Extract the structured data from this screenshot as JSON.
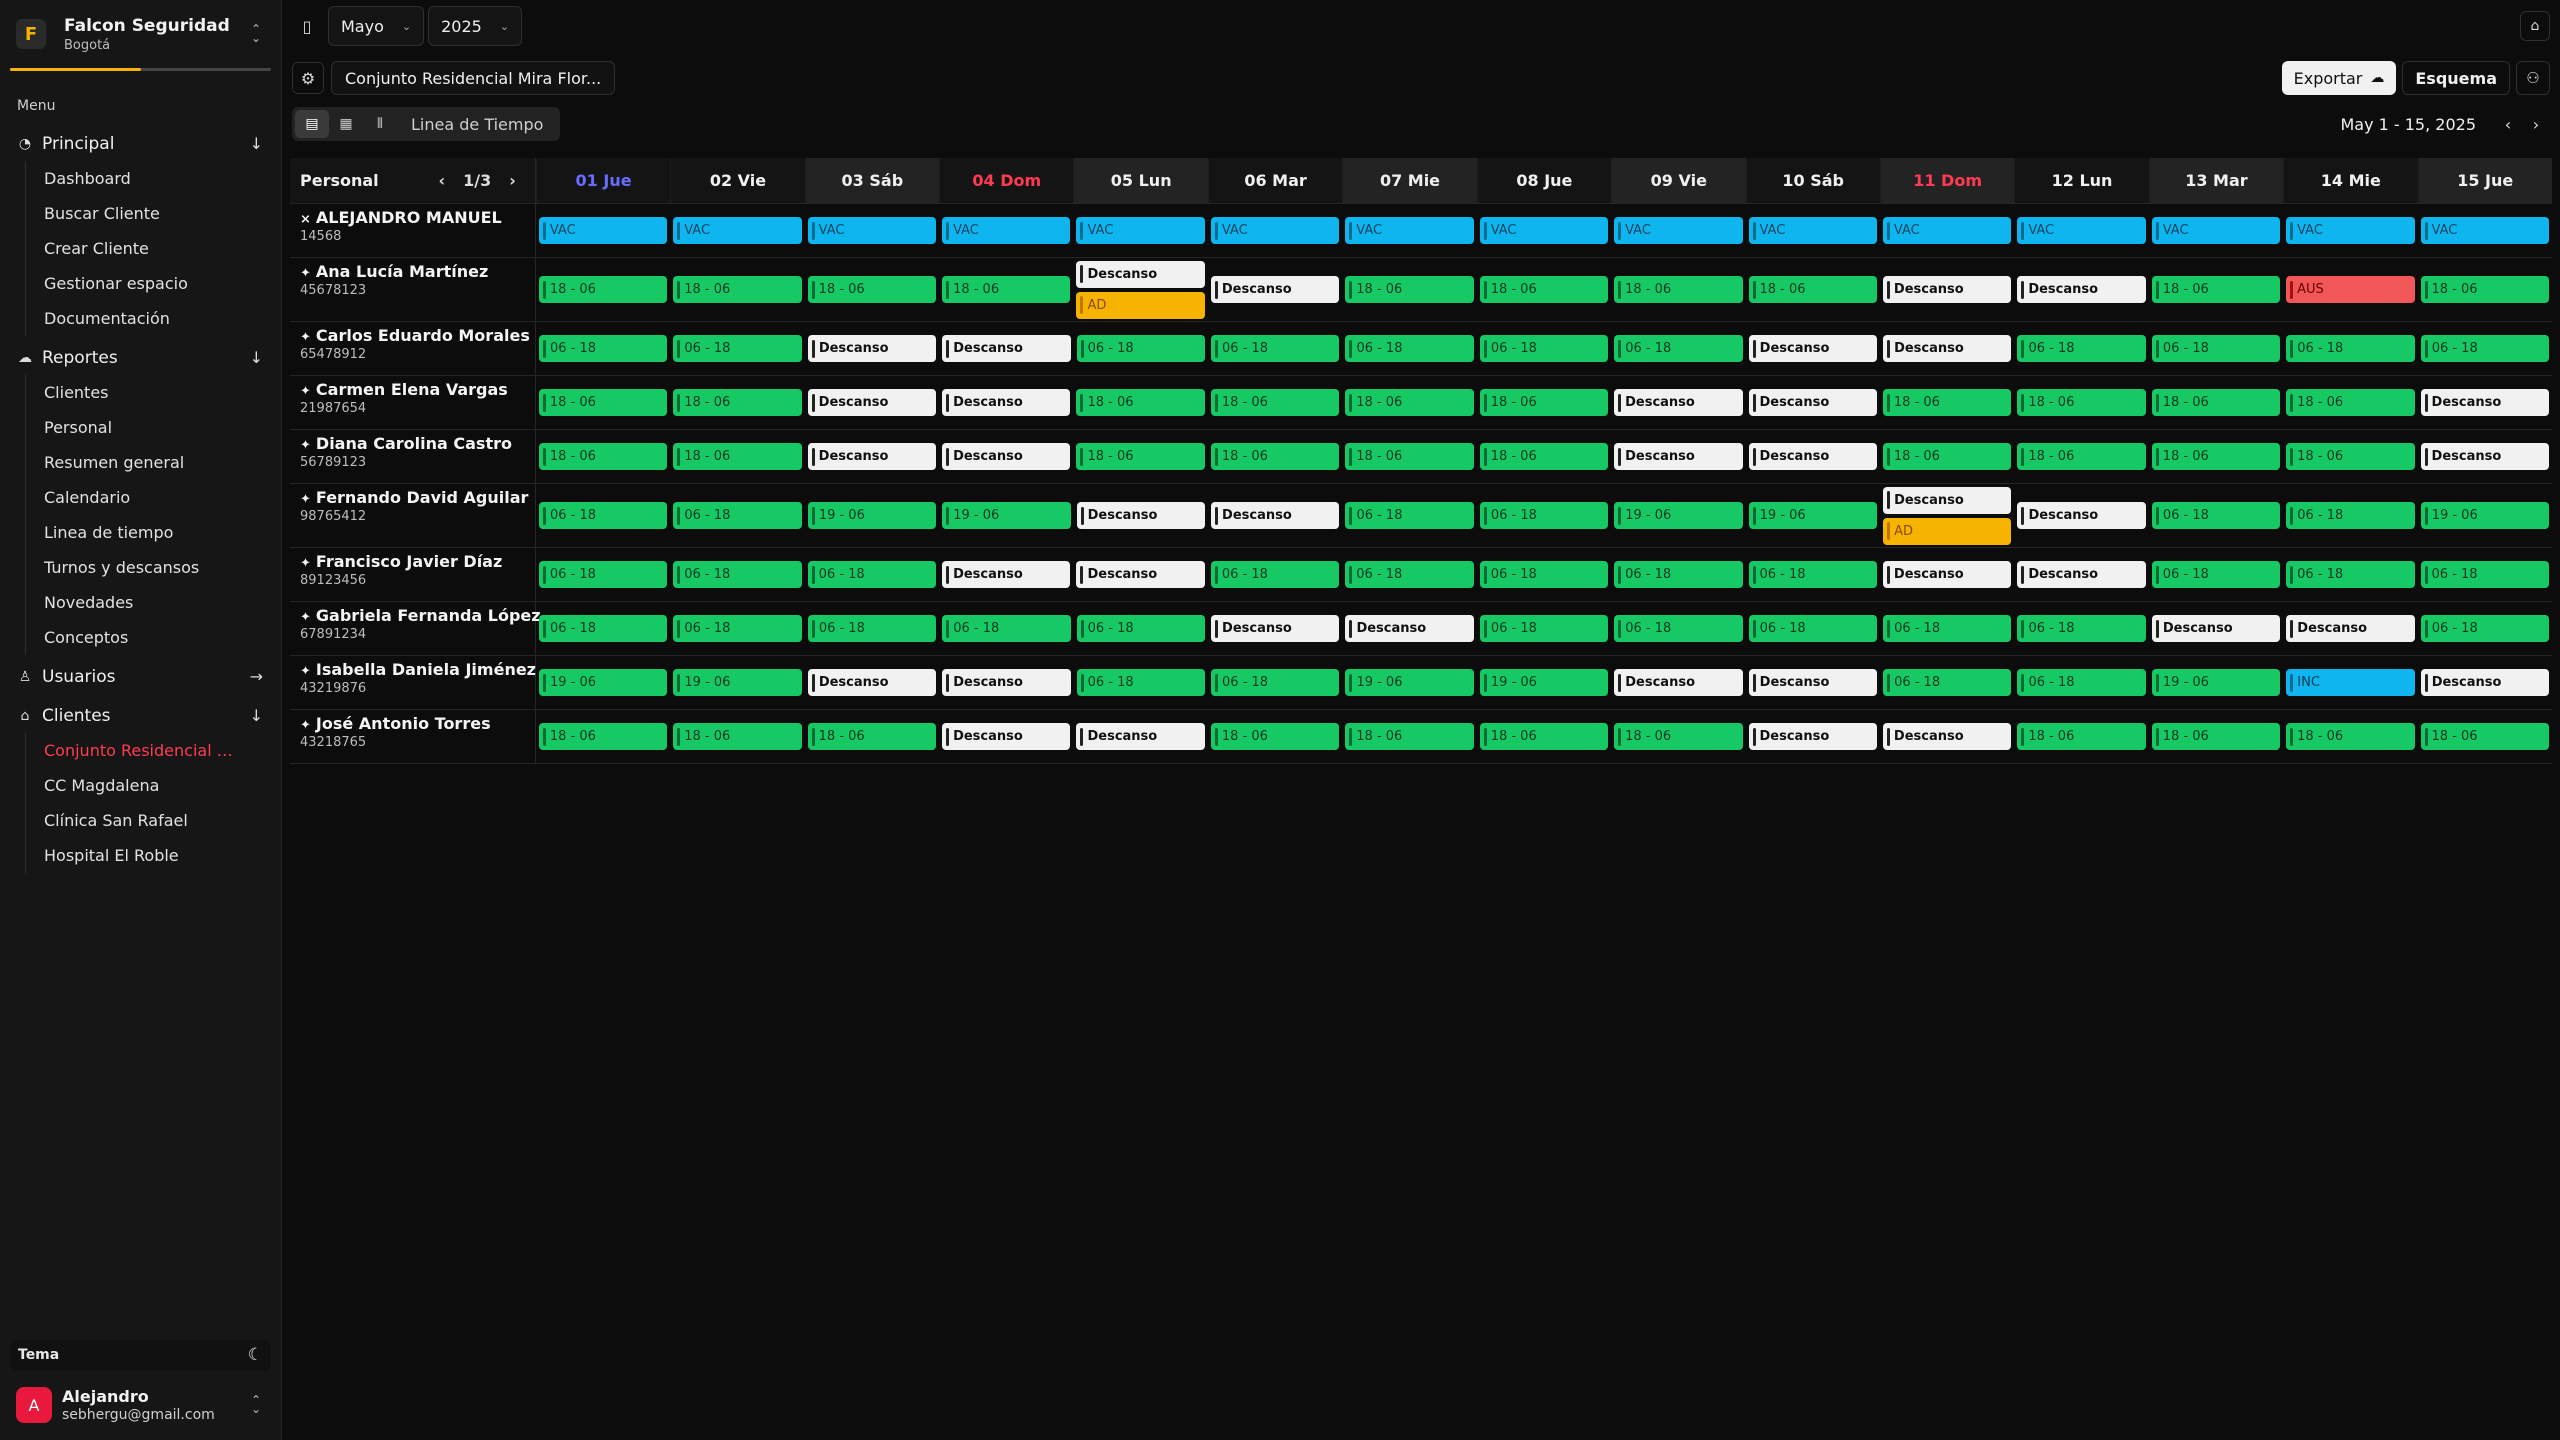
{
  "org": {
    "name": "Falcon Seguridad",
    "city": "Bogotá",
    "logo_letter": "F",
    "progress_fraction": 0.5
  },
  "menu_title": "Menu",
  "nav": [
    {
      "label": "Principal",
      "icon": "dashboard-icon",
      "arrow": "↓",
      "items": [
        "Dashboard",
        "Buscar Cliente",
        "Crear Cliente",
        "Gestionar espacio",
        "Documentación"
      ]
    },
    {
      "label": "Reportes",
      "icon": "cloud-icon",
      "arrow": "↓",
      "items": [
        "Clientes",
        "Personal",
        "Resumen general",
        "Calendario",
        "Linea de tiempo",
        "Turnos y descansos",
        "Novedades",
        "Conceptos"
      ]
    },
    {
      "label": "Usuarios",
      "icon": "user-icon",
      "arrow": "→",
      "items": []
    },
    {
      "label": "Clientes",
      "icon": "building-icon",
      "arrow": "↓",
      "items": [
        "Conjunto Residencial M...",
        "CC Magdalena",
        "Clínica San Rafael",
        "Hospital El Roble"
      ],
      "active_index": 0
    }
  ],
  "theme_label": "Tema",
  "user": {
    "name": "Alejandro",
    "email": "sebhergu@gmail.com",
    "initial": "A"
  },
  "topbar": {
    "month": "Mayo",
    "year": "2025"
  },
  "toolbar": {
    "client": "Conjunto Residencial Mira Flor...",
    "export": "Exportar",
    "schema": "Esquema"
  },
  "viewbar": {
    "label": "Linea de Tiempo",
    "range": "May 1 - 15, 2025"
  },
  "grid": {
    "personal_label": "Personal",
    "page": "1/3",
    "days": [
      {
        "label": "01 Jue",
        "kind": "today"
      },
      {
        "label": "02 Vie",
        "kind": ""
      },
      {
        "label": "03 Sáb",
        "kind": "alt"
      },
      {
        "label": "04 Dom",
        "kind": "sun"
      },
      {
        "label": "05 Lun",
        "kind": "alt"
      },
      {
        "label": "06 Mar",
        "kind": ""
      },
      {
        "label": "07 Mie",
        "kind": "alt"
      },
      {
        "label": "08 Jue",
        "kind": ""
      },
      {
        "label": "09 Vie",
        "kind": "alt"
      },
      {
        "label": "10 Sáb",
        "kind": ""
      },
      {
        "label": "11 Dom",
        "kind": "sun alt"
      },
      {
        "label": "12 Lun",
        "kind": ""
      },
      {
        "label": "13 Mar",
        "kind": "alt"
      },
      {
        "label": "14 Mie",
        "kind": ""
      },
      {
        "label": "15 Jue",
        "kind": "alt"
      }
    ],
    "employees": [
      {
        "name": "ALEJANDRO MANUEL",
        "id": "14568",
        "pin": "off",
        "days": [
          [
            "VAC"
          ],
          [
            "VAC"
          ],
          [
            "VAC"
          ],
          [
            "VAC"
          ],
          [
            "VAC"
          ],
          [
            "VAC"
          ],
          [
            "VAC"
          ],
          [
            "VAC"
          ],
          [
            "VAC"
          ],
          [
            "VAC"
          ],
          [
            "VAC"
          ],
          [
            "VAC"
          ],
          [
            "VAC"
          ],
          [
            "VAC"
          ],
          [
            "VAC"
          ]
        ]
      },
      {
        "name": "Ana Lucía Martínez",
        "id": "45678123",
        "pin": "on",
        "days": [
          [
            "18 - 06"
          ],
          [
            "18 - 06"
          ],
          [
            "18 - 06"
          ],
          [
            "18 - 06"
          ],
          [
            "Descanso",
            "AD"
          ],
          [
            "Descanso"
          ],
          [
            "18 - 06"
          ],
          [
            "18 - 06"
          ],
          [
            "18 - 06"
          ],
          [
            "18 - 06"
          ],
          [
            "Descanso"
          ],
          [
            "Descanso"
          ],
          [
            "18 - 06"
          ],
          [
            "AUS"
          ],
          [
            "18 - 06"
          ]
        ]
      },
      {
        "name": "Carlos Eduardo Morales",
        "id": "65478912",
        "pin": "on",
        "days": [
          [
            "06 - 18"
          ],
          [
            "06 - 18"
          ],
          [
            "Descanso"
          ],
          [
            "Descanso"
          ],
          [
            "06 - 18"
          ],
          [
            "06 - 18"
          ],
          [
            "06 - 18"
          ],
          [
            "06 - 18"
          ],
          [
            "06 - 18"
          ],
          [
            "Descanso"
          ],
          [
            "Descanso"
          ],
          [
            "06 - 18"
          ],
          [
            "06 - 18"
          ],
          [
            "06 - 18"
          ],
          [
            "06 - 18"
          ]
        ]
      },
      {
        "name": "Carmen Elena Vargas",
        "id": "21987654",
        "pin": "on",
        "days": [
          [
            "18 - 06"
          ],
          [
            "18 - 06"
          ],
          [
            "Descanso"
          ],
          [
            "Descanso"
          ],
          [
            "18 - 06"
          ],
          [
            "18 - 06"
          ],
          [
            "18 - 06"
          ],
          [
            "18 - 06"
          ],
          [
            "Descanso"
          ],
          [
            "Descanso"
          ],
          [
            "18 - 06"
          ],
          [
            "18 - 06"
          ],
          [
            "18 - 06"
          ],
          [
            "18 - 06"
          ],
          [
            "Descanso"
          ]
        ]
      },
      {
        "name": "Diana Carolina Castro",
        "id": "56789123",
        "pin": "on",
        "days": [
          [
            "18 - 06"
          ],
          [
            "18 - 06"
          ],
          [
            "Descanso"
          ],
          [
            "Descanso"
          ],
          [
            "18 - 06"
          ],
          [
            "18 - 06"
          ],
          [
            "18 - 06"
          ],
          [
            "18 - 06"
          ],
          [
            "Descanso"
          ],
          [
            "Descanso"
          ],
          [
            "18 - 06"
          ],
          [
            "18 - 06"
          ],
          [
            "18 - 06"
          ],
          [
            "18 - 06"
          ],
          [
            "Descanso"
          ]
        ]
      },
      {
        "name": "Fernando David Aguilar",
        "id": "98765412",
        "pin": "on",
        "days": [
          [
            "06 - 18"
          ],
          [
            "06 - 18"
          ],
          [
            "19 - 06"
          ],
          [
            "19 - 06"
          ],
          [
            "Descanso"
          ],
          [
            "Descanso"
          ],
          [
            "06 - 18"
          ],
          [
            "06 - 18"
          ],
          [
            "19 - 06"
          ],
          [
            "19 - 06"
          ],
          [
            "Descanso",
            "AD"
          ],
          [
            "Descanso"
          ],
          [
            "06 - 18"
          ],
          [
            "06 - 18"
          ],
          [
            "19 - 06"
          ]
        ]
      },
      {
        "name": "Francisco Javier Díaz",
        "id": "89123456",
        "pin": "on",
        "days": [
          [
            "06 - 18"
          ],
          [
            "06 - 18"
          ],
          [
            "06 - 18"
          ],
          [
            "Descanso"
          ],
          [
            "Descanso"
          ],
          [
            "06 - 18"
          ],
          [
            "06 - 18"
          ],
          [
            "06 - 18"
          ],
          [
            "06 - 18"
          ],
          [
            "06 - 18"
          ],
          [
            "Descanso"
          ],
          [
            "Descanso"
          ],
          [
            "06 - 18"
          ],
          [
            "06 - 18"
          ],
          [
            "06 - 18"
          ]
        ]
      },
      {
        "name": "Gabriela Fernanda López",
        "id": "67891234",
        "pin": "on",
        "days": [
          [
            "06 - 18"
          ],
          [
            "06 - 18"
          ],
          [
            "06 - 18"
          ],
          [
            "06 - 18"
          ],
          [
            "06 - 18"
          ],
          [
            "Descanso"
          ],
          [
            "Descanso"
          ],
          [
            "06 - 18"
          ],
          [
            "06 - 18"
          ],
          [
            "06 - 18"
          ],
          [
            "06 - 18"
          ],
          [
            "06 - 18"
          ],
          [
            "Descanso"
          ],
          [
            "Descanso"
          ],
          [
            "06 - 18"
          ]
        ]
      },
      {
        "name": "Isabella Daniela Jiménez",
        "id": "43219876",
        "pin": "on",
        "days": [
          [
            "19 - 06"
          ],
          [
            "19 - 06"
          ],
          [
            "Descanso"
          ],
          [
            "Descanso"
          ],
          [
            "06 - 18"
          ],
          [
            "06 - 18"
          ],
          [
            "19 - 06"
          ],
          [
            "19 - 06"
          ],
          [
            "Descanso"
          ],
          [
            "Descanso"
          ],
          [
            "06 - 18"
          ],
          [
            "06 - 18"
          ],
          [
            "19 - 06"
          ],
          [
            "INC"
          ],
          [
            "Descanso"
          ]
        ]
      },
      {
        "name": "José Antonio Torres",
        "id": "43218765",
        "pin": "on",
        "days": [
          [
            "18 - 06"
          ],
          [
            "18 - 06"
          ],
          [
            "18 - 06"
          ],
          [
            "Descanso"
          ],
          [
            "Descanso"
          ],
          [
            "18 - 06"
          ],
          [
            "18 - 06"
          ],
          [
            "18 - 06"
          ],
          [
            "18 - 06"
          ],
          [
            "Descanso"
          ],
          [
            "Descanso"
          ],
          [
            "18 - 06"
          ],
          [
            "18 - 06"
          ],
          [
            "18 - 06"
          ],
          [
            "18 - 06"
          ]
        ]
      }
    ]
  },
  "colors": {
    "accent": "#f6b400",
    "turno": "#17c964",
    "vac": "#0fb5ef",
    "descanso": "#f1f1f1",
    "ad": "#f6b400",
    "aus": "#f25757",
    "active": "#ff3b53"
  }
}
